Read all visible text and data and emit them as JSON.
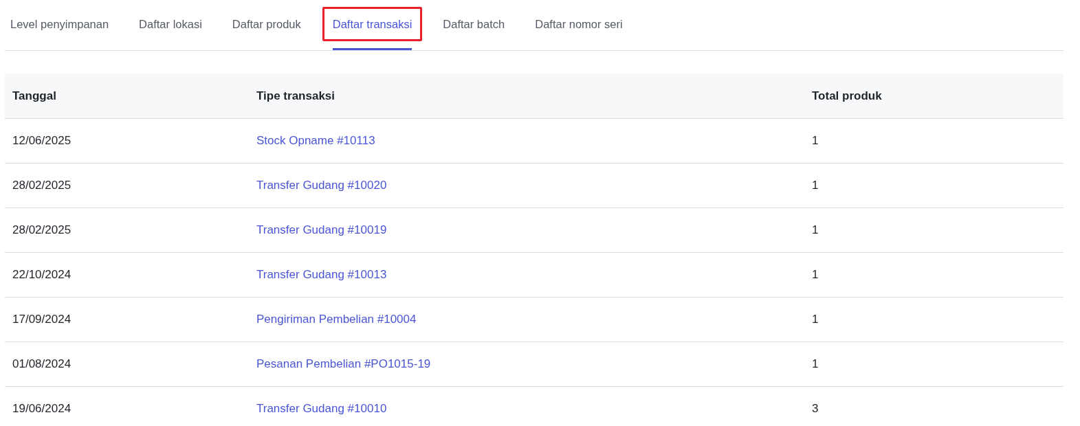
{
  "tabs": [
    {
      "label": "Level penyimpanan",
      "selected": false,
      "highlighted": false
    },
    {
      "label": "Daftar lokasi",
      "selected": false,
      "highlighted": false
    },
    {
      "label": "Daftar produk",
      "selected": false,
      "highlighted": false
    },
    {
      "label": "Daftar transaksi",
      "selected": true,
      "highlighted": true
    },
    {
      "label": "Daftar batch",
      "selected": false,
      "highlighted": false
    },
    {
      "label": "Daftar nomor seri",
      "selected": false,
      "highlighted": false
    }
  ],
  "table": {
    "columns": [
      "Tanggal",
      "Tipe transaksi",
      "Total produk"
    ],
    "rows": [
      {
        "date": "12/06/2025",
        "transaction": "Stock Opname #10113",
        "total": "1"
      },
      {
        "date": "28/02/2025",
        "transaction": "Transfer Gudang #10020",
        "total": "1"
      },
      {
        "date": "28/02/2025",
        "transaction": "Transfer Gudang #10019",
        "total": "1"
      },
      {
        "date": "22/10/2024",
        "transaction": "Transfer Gudang #10013",
        "total": "1"
      },
      {
        "date": "17/09/2024",
        "transaction": "Pengiriman Pembelian #10004",
        "total": "1"
      },
      {
        "date": "01/08/2024",
        "transaction": "Pesanan Pembelian #PO1015-19",
        "total": "1"
      },
      {
        "date": "19/06/2024",
        "transaction": "Transfer Gudang #10010",
        "total": "3"
      }
    ]
  }
}
